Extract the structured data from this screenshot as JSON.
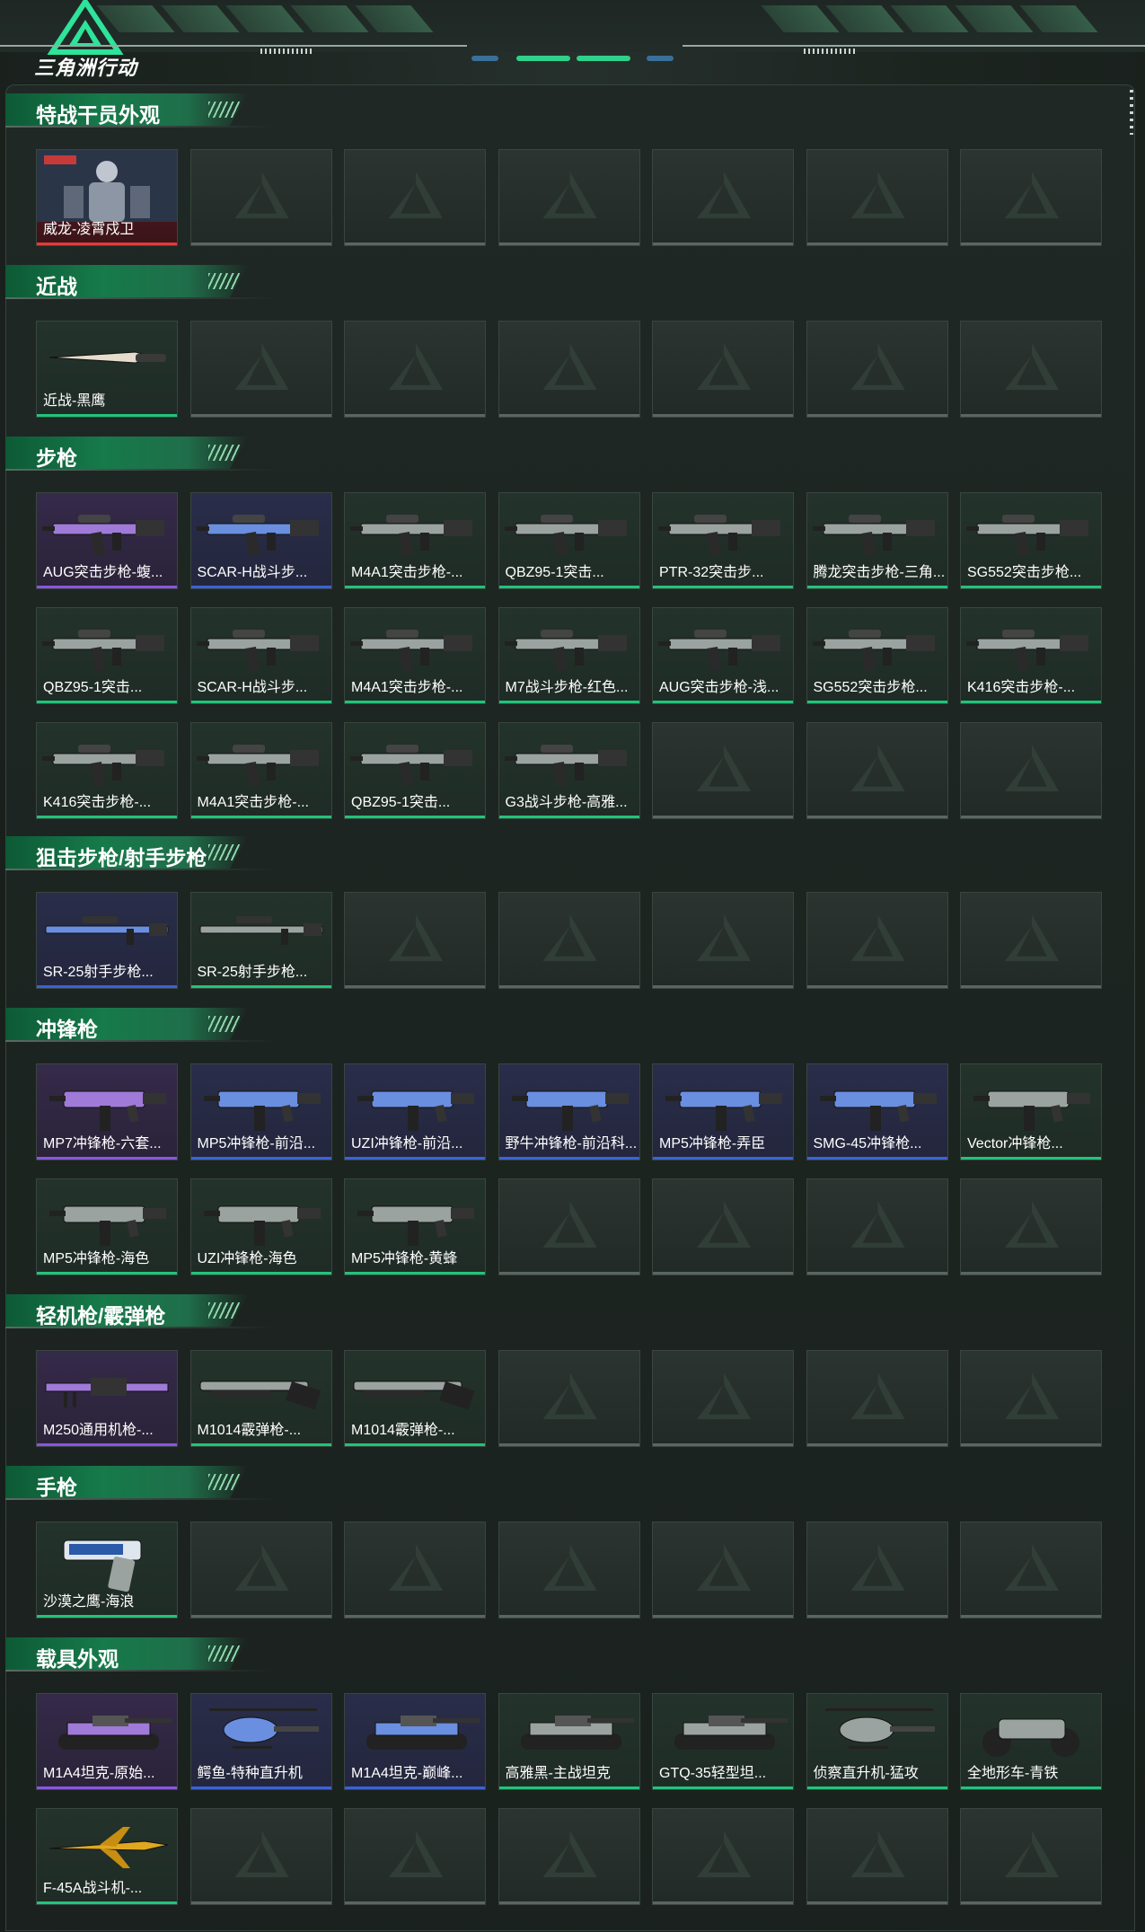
{
  "app": {
    "title": "三角洲行动"
  },
  "colors": {
    "green_bar": "#21c47a",
    "blue_bar": "#3a62d8",
    "purple_bar": "#8a56e0",
    "red_bar": "#e23b3b",
    "accent": "#167a4a"
  },
  "sections": [
    {
      "title": "特战干员外观",
      "rows": 1,
      "items": [
        {
          "label": "威龙-凌霄戍卫",
          "rarity": "red",
          "icon": "operator-icon"
        }
      ]
    },
    {
      "title": "近战",
      "rows": 1,
      "items": [
        {
          "label": "近战-黑鹰",
          "rarity": "green",
          "icon": "knife-icon"
        }
      ]
    },
    {
      "title": "步枪",
      "rows": 3,
      "items": [
        {
          "label": "AUG突击步枪-蝮...",
          "rarity": "purple",
          "icon": "rifle-icon"
        },
        {
          "label": "SCAR-H战斗步...",
          "rarity": "blue",
          "icon": "rifle-icon"
        },
        {
          "label": "M4A1突击步枪-...",
          "rarity": "green",
          "icon": "rifle-icon"
        },
        {
          "label": "QBZ95-1突击...",
          "rarity": "green",
          "icon": "rifle-icon"
        },
        {
          "label": "PTR-32突击步...",
          "rarity": "green",
          "icon": "rifle-icon"
        },
        {
          "label": "腾龙突击步枪-三角...",
          "rarity": "green",
          "icon": "rifle-icon"
        },
        {
          "label": "SG552突击步枪...",
          "rarity": "green",
          "icon": "rifle-icon"
        },
        {
          "label": "QBZ95-1突击...",
          "rarity": "green",
          "icon": "rifle-icon"
        },
        {
          "label": "SCAR-H战斗步...",
          "rarity": "green",
          "icon": "rifle-icon"
        },
        {
          "label": "M4A1突击步枪-...",
          "rarity": "green",
          "icon": "rifle-icon"
        },
        {
          "label": "M7战斗步枪-红色...",
          "rarity": "green",
          "icon": "rifle-icon"
        },
        {
          "label": "AUG突击步枪-浅...",
          "rarity": "green",
          "icon": "rifle-icon"
        },
        {
          "label": "SG552突击步枪...",
          "rarity": "green",
          "icon": "rifle-icon"
        },
        {
          "label": "K416突击步枪-...",
          "rarity": "green",
          "icon": "rifle-icon"
        },
        {
          "label": "K416突击步枪-...",
          "rarity": "green",
          "icon": "rifle-icon"
        },
        {
          "label": "M4A1突击步枪-...",
          "rarity": "green",
          "icon": "rifle-icon"
        },
        {
          "label": "QBZ95-1突击...",
          "rarity": "green",
          "icon": "rifle-icon"
        },
        {
          "label": "G3战斗步枪-高雅...",
          "rarity": "green",
          "icon": "rifle-icon"
        }
      ]
    },
    {
      "title": "狙击步枪/射手步枪",
      "rows": 1,
      "items": [
        {
          "label": "SR-25射手步枪...",
          "rarity": "blue",
          "icon": "sniper-icon"
        },
        {
          "label": "SR-25射手步枪...",
          "rarity": "green",
          "icon": "sniper-icon"
        }
      ]
    },
    {
      "title": "冲锋枪",
      "rows": 2,
      "items": [
        {
          "label": "MP7冲锋枪-六套...",
          "rarity": "purple",
          "icon": "smg-icon"
        },
        {
          "label": "MP5冲锋枪-前沿...",
          "rarity": "blue",
          "icon": "smg-icon"
        },
        {
          "label": "UZI冲锋枪-前沿...",
          "rarity": "blue",
          "icon": "smg-icon"
        },
        {
          "label": "野牛冲锋枪-前沿科...",
          "rarity": "blue",
          "icon": "smg-icon"
        },
        {
          "label": "MP5冲锋枪-弄臣",
          "rarity": "blue",
          "icon": "smg-icon"
        },
        {
          "label": "SMG-45冲锋枪...",
          "rarity": "blue",
          "icon": "smg-icon"
        },
        {
          "label": "Vector冲锋枪...",
          "rarity": "green",
          "icon": "smg-icon"
        },
        {
          "label": "MP5冲锋枪-海色",
          "rarity": "green",
          "icon": "smg-icon"
        },
        {
          "label": "UZI冲锋枪-海色",
          "rarity": "green",
          "icon": "smg-icon"
        },
        {
          "label": "MP5冲锋枪-黄蜂",
          "rarity": "green",
          "icon": "smg-icon"
        }
      ]
    },
    {
      "title": "轻机枪/霰弹枪",
      "rows": 1,
      "items": [
        {
          "label": "M250通用机枪-...",
          "rarity": "purple",
          "icon": "lmg-icon"
        },
        {
          "label": "M1014霰弹枪-...",
          "rarity": "green",
          "icon": "shotgun-icon"
        },
        {
          "label": "M1014霰弹枪-...",
          "rarity": "green",
          "icon": "shotgun-icon"
        }
      ]
    },
    {
      "title": "手枪",
      "rows": 1,
      "items": [
        {
          "label": "沙漠之鹰-海浪",
          "rarity": "green",
          "icon": "pistol-icon"
        }
      ]
    },
    {
      "title": "载具外观",
      "rows": 2,
      "items": [
        {
          "label": "M1A4坦克-原始...",
          "rarity": "purple",
          "icon": "tank-icon"
        },
        {
          "label": "鳄鱼-特种直升机",
          "rarity": "blue",
          "icon": "helicopter-icon"
        },
        {
          "label": "M1A4坦克-巅峰...",
          "rarity": "blue",
          "icon": "tank-icon"
        },
        {
          "label": "高雅黑-主战坦克",
          "rarity": "green",
          "icon": "tank-icon"
        },
        {
          "label": "GTQ-35轻型坦...",
          "rarity": "green",
          "icon": "tank-icon"
        },
        {
          "label": "侦察直升机-猛攻",
          "rarity": "green",
          "icon": "helicopter-icon"
        },
        {
          "label": "全地形车-青铁",
          "rarity": "green",
          "icon": "atv-icon"
        },
        {
          "label": "F-45A战斗机-...",
          "rarity": "green",
          "icon": "jet-icon"
        }
      ]
    }
  ]
}
